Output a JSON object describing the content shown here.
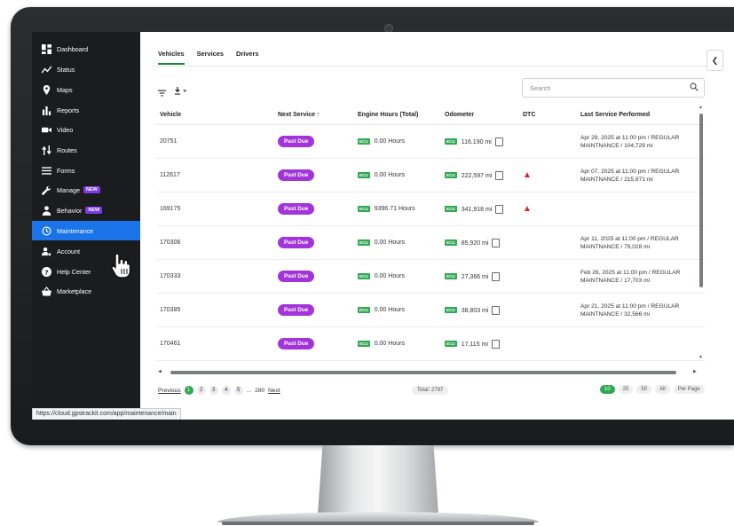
{
  "sidebar": {
    "items": [
      {
        "label": "Dashboard",
        "icon": "dashboard-icon"
      },
      {
        "label": "Status",
        "icon": "trend-icon"
      },
      {
        "label": "Maps",
        "icon": "map-pin-icon"
      },
      {
        "label": "Reports",
        "icon": "bar-chart-icon"
      },
      {
        "label": "Video",
        "icon": "video-icon"
      },
      {
        "label": "Routes",
        "icon": "routes-icon"
      },
      {
        "label": "Forms",
        "icon": "forms-icon"
      },
      {
        "label": "Manage",
        "icon": "wrench-icon",
        "badge": "NEW"
      },
      {
        "label": "Behavior",
        "icon": "person-icon",
        "badge": "NEW"
      },
      {
        "label": "Maintenance",
        "icon": "maintenance-icon",
        "active": true
      },
      {
        "label": "Account",
        "icon": "account-icon"
      },
      {
        "label": "Help Center",
        "icon": "help-icon"
      },
      {
        "label": "Marketplace",
        "icon": "basket-icon"
      }
    ]
  },
  "status_url": "https://cloud.gpstrackit.com/app/maintenance/main",
  "tabs": [
    {
      "label": "Vehicles",
      "active": true
    },
    {
      "label": "Services"
    },
    {
      "label": "Drivers"
    }
  ],
  "search": {
    "placeholder": "Search"
  },
  "table": {
    "columns": [
      "Vehicle",
      "Next Service ↑",
      "Engine Hours (Total)",
      "Odometer",
      "DTC",
      "Last Service Performed"
    ],
    "ecu_label": "ECU",
    "rows": [
      {
        "vehicle": "20751",
        "next_service": "Past Due",
        "engine_hours": "0.00 Hours",
        "odometer": "116,190 mi",
        "dtc": false,
        "last_service_1": "Apr 29, 2025 at 11:00 pm / REGULAR",
        "last_service_2": "MAINTNANCE / 104,729 mi"
      },
      {
        "vehicle": "112617",
        "next_service": "Past Due",
        "engine_hours": "0.00 Hours",
        "odometer": "222,597 mi",
        "dtc": true,
        "last_service_1": "Apr 07, 2025 at 11:00 pm / REGULAR",
        "last_service_2": "MAINTNANCE / 215,971 mi"
      },
      {
        "vehicle": "169175",
        "next_service": "Past Due",
        "engine_hours": "9396.71 Hours",
        "odometer": "341,918 mi",
        "dtc": true,
        "last_service_1": "",
        "last_service_2": ""
      },
      {
        "vehicle": "170306",
        "next_service": "Past Due",
        "engine_hours": "0.00 Hours",
        "odometer": "85,920 mi",
        "dtc": false,
        "last_service_1": "Apr 11, 2025 at 11:00 pm / REGULAR",
        "last_service_2": "MAINTNANCE / 79,028 mi"
      },
      {
        "vehicle": "170333",
        "next_service": "Past Due",
        "engine_hours": "0.00 Hours",
        "odometer": "27,366 mi",
        "dtc": false,
        "last_service_1": "Feb 26, 2025 at 11:00 pm / REGULAR",
        "last_service_2": "MAINTNANCE / 17,703 mi"
      },
      {
        "vehicle": "170385",
        "next_service": "Past Due",
        "engine_hours": "0.00 Hours",
        "odometer": "38,803 mi",
        "dtc": false,
        "last_service_1": "Apr 21, 2025 at 11:00 pm / REGULAR",
        "last_service_2": "MAINTNANCE / 32,566 mi"
      },
      {
        "vehicle": "170461",
        "next_service": "Past Due",
        "engine_hours": "0.00 Hours",
        "odometer": "17,115 mi",
        "dtc": false,
        "last_service_1": "",
        "last_service_2": ""
      }
    ]
  },
  "pagination": {
    "previous": "Previous",
    "pages": [
      "1",
      "2",
      "3",
      "4",
      "5",
      "...",
      "280"
    ],
    "next": "Next",
    "total": "Total: 2797",
    "per_page_options": [
      "10",
      "25",
      "50",
      "All",
      "Per Page"
    ]
  },
  "colors": {
    "accent_blue": "#1a73e8",
    "pill_purple": "#a234d9",
    "green": "#31a853",
    "warn_red": "#e02020"
  }
}
